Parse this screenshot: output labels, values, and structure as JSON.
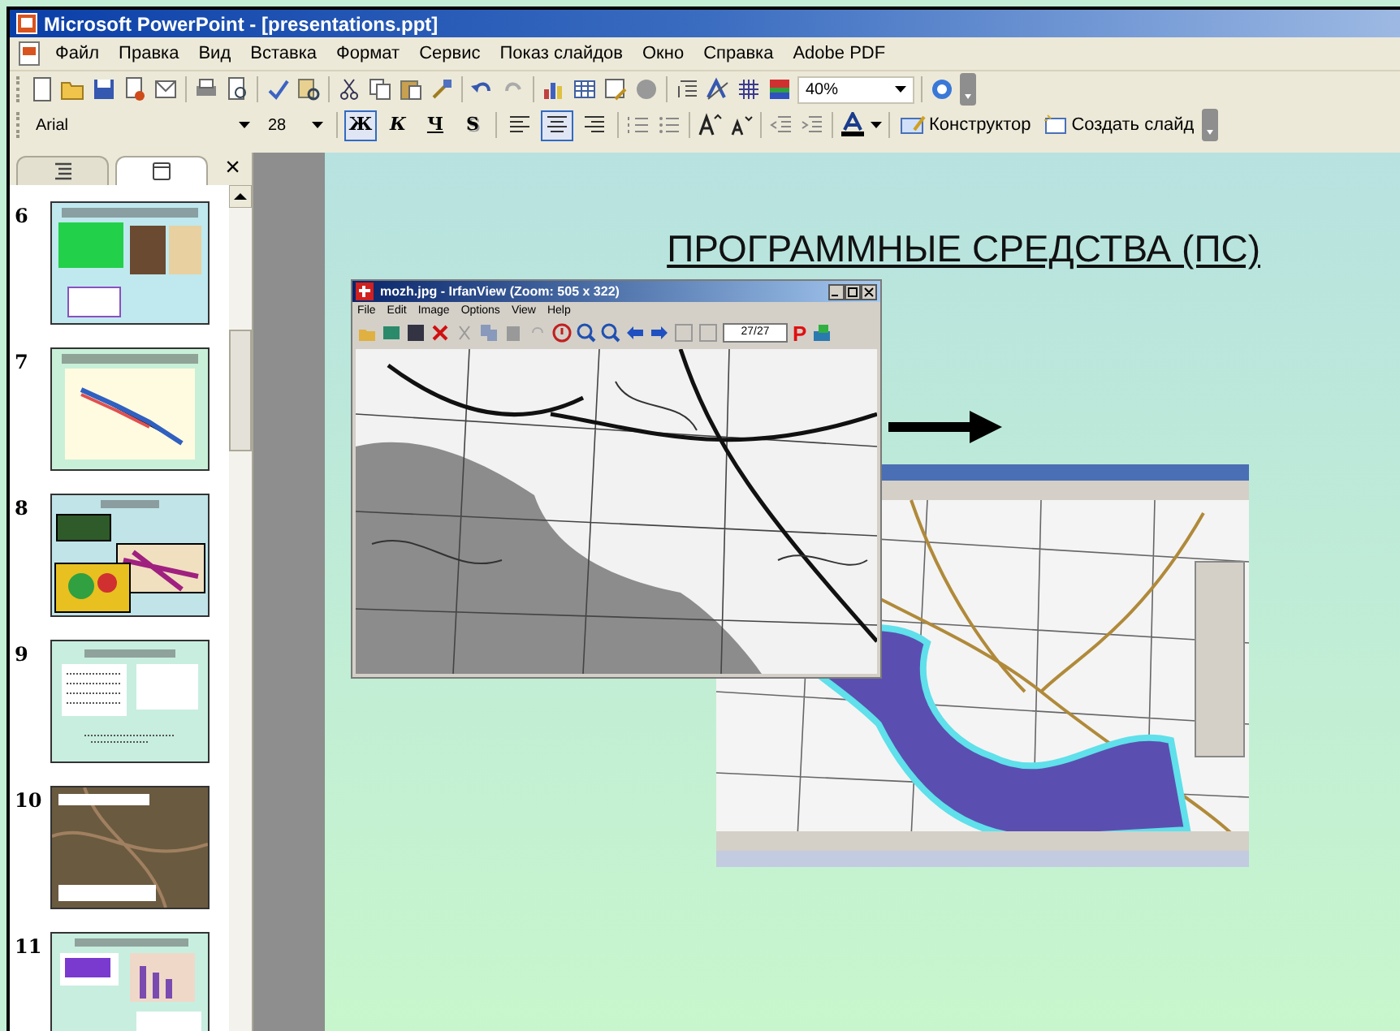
{
  "window": {
    "title": "Microsoft PowerPoint - [presentations.ppt]"
  },
  "menu": [
    "Файл",
    "Правка",
    "Вид",
    "Вставка",
    "Формат",
    "Сервис",
    "Показ слайдов",
    "Окно",
    "Справка",
    "Adobe PDF"
  ],
  "standard_toolbar": {
    "zoom": "40%"
  },
  "formatting_toolbar": {
    "font": "Arial",
    "size": "28",
    "styles": [
      {
        "label": "Ж",
        "selected": true
      },
      {
        "label": "К",
        "selected": false
      },
      {
        "label": "Ч",
        "selected": false
      },
      {
        "label": "S",
        "selected": false
      }
    ],
    "align": [
      {
        "kind": "left",
        "selected": false
      },
      {
        "kind": "center",
        "selected": true
      },
      {
        "kind": "right",
        "selected": false
      }
    ],
    "designer": "Конструктор",
    "new_slide": "Создать слайд"
  },
  "pane": {
    "tabs": [
      {
        "kind": "outline",
        "selected": false
      },
      {
        "kind": "slides",
        "selected": true
      }
    ],
    "close": "×",
    "slides": [
      {
        "number": "6",
        "kind": "green"
      },
      {
        "number": "7",
        "kind": "chart"
      },
      {
        "number": "8",
        "kind": "maps"
      },
      {
        "number": "9",
        "kind": "text"
      },
      {
        "number": "10",
        "kind": "photo"
      },
      {
        "number": "11",
        "kind": "charts"
      }
    ]
  },
  "slide": {
    "title": "ПРОГРАММНЫЕ СРЕДСТВА (ПС)",
    "viewer": {
      "title": "mozh.jpg - IrfanView (Zoom: 505 x 322)",
      "menu": [
        "File",
        "Edit",
        "Image",
        "Options",
        "View",
        "Help"
      ],
      "counter": "27/27",
      "p_button": "P"
    }
  }
}
